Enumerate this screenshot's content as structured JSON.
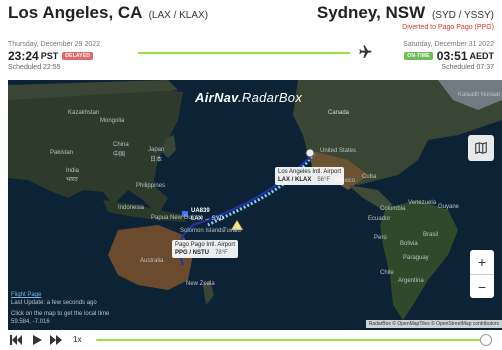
{
  "header": {
    "origin": {
      "city": "Los Angeles, CA",
      "codes": "(LAX / KLAX)",
      "date": "Thursday, December 29 2022",
      "time": "23:24",
      "tz": "PST",
      "status": "DELAYED",
      "scheduled": "Scheduled 22:55"
    },
    "destination": {
      "city": "Sydney, NSW",
      "codes": "(SYD / YSSY)",
      "diverted": "Diverted to Pago Pago (PPG)",
      "date": "Saturday, December 31 2022",
      "time": "03:51",
      "tz": "AEDT",
      "status": "ON-TIME",
      "scheduled": "Scheduled 07:37"
    },
    "progress": 1.0,
    "plane_icon": "airplane-icon"
  },
  "map": {
    "brand": {
      "part1": "AirNav",
      "dot": ".",
      "part2": "RadarBox"
    },
    "labels": {
      "kazakhstan": "Kazakhstan",
      "mongolia": "Mongolia",
      "japan": "Japan",
      "japan_jp": "日本",
      "china": "China",
      "china_cn": "中国",
      "pakistan": "Pakistan",
      "india": "India",
      "india_hi": "भारत",
      "philippines": "Philippines",
      "indonesia": "Indonesia",
      "png": "Papua New Guinea",
      "solomon": "Solomon Islands",
      "tuvalu": "Tuvalu",
      "australia": "Australia",
      "new_zealand": "New Zeala",
      "canada": "Canada",
      "united_states": "United States",
      "mexico": "México",
      "cuba": "Cuba",
      "venezuela": "Venezuela",
      "colombia": "Colombia",
      "ecuador": "Ecuador",
      "peru": "Perú",
      "brasil": "Brasil",
      "bolivia": "Bolivia",
      "paraguay": "Paraguay",
      "argentina": "Argentina",
      "chile": "Chile",
      "greenland": "Kalaallit Nunaat",
      "guyana": "Guyane"
    },
    "lax_card": {
      "name": "Los Angeles Intl. Airport",
      "code": "LAX / KLAX",
      "temp": "56°F"
    },
    "ppg_card": {
      "name": "Pago Pago Intl. Airport",
      "code": "PPG / NSTU",
      "temp": "78°F"
    },
    "flight": {
      "number": "UA839",
      "route": "LAX → SYD"
    },
    "info": {
      "link": "Flight Page",
      "updated": "Last Update: a few seconds ago",
      "hint": "Click on the map to get the local time",
      "coords": "59.584, -7.016"
    },
    "attribution": "RadarBox © OpenMapTiles © OpenStreetMap contributors",
    "zoom_in": "+",
    "zoom_out": "−"
  },
  "playback": {
    "speed": "1x"
  },
  "colors": {
    "accent": "#9be13f",
    "delayed": "#e46969",
    "ontime": "#6bbd57",
    "diverted": "#d9342b",
    "route": "#2233aa",
    "path": "#7fd0ff"
  }
}
